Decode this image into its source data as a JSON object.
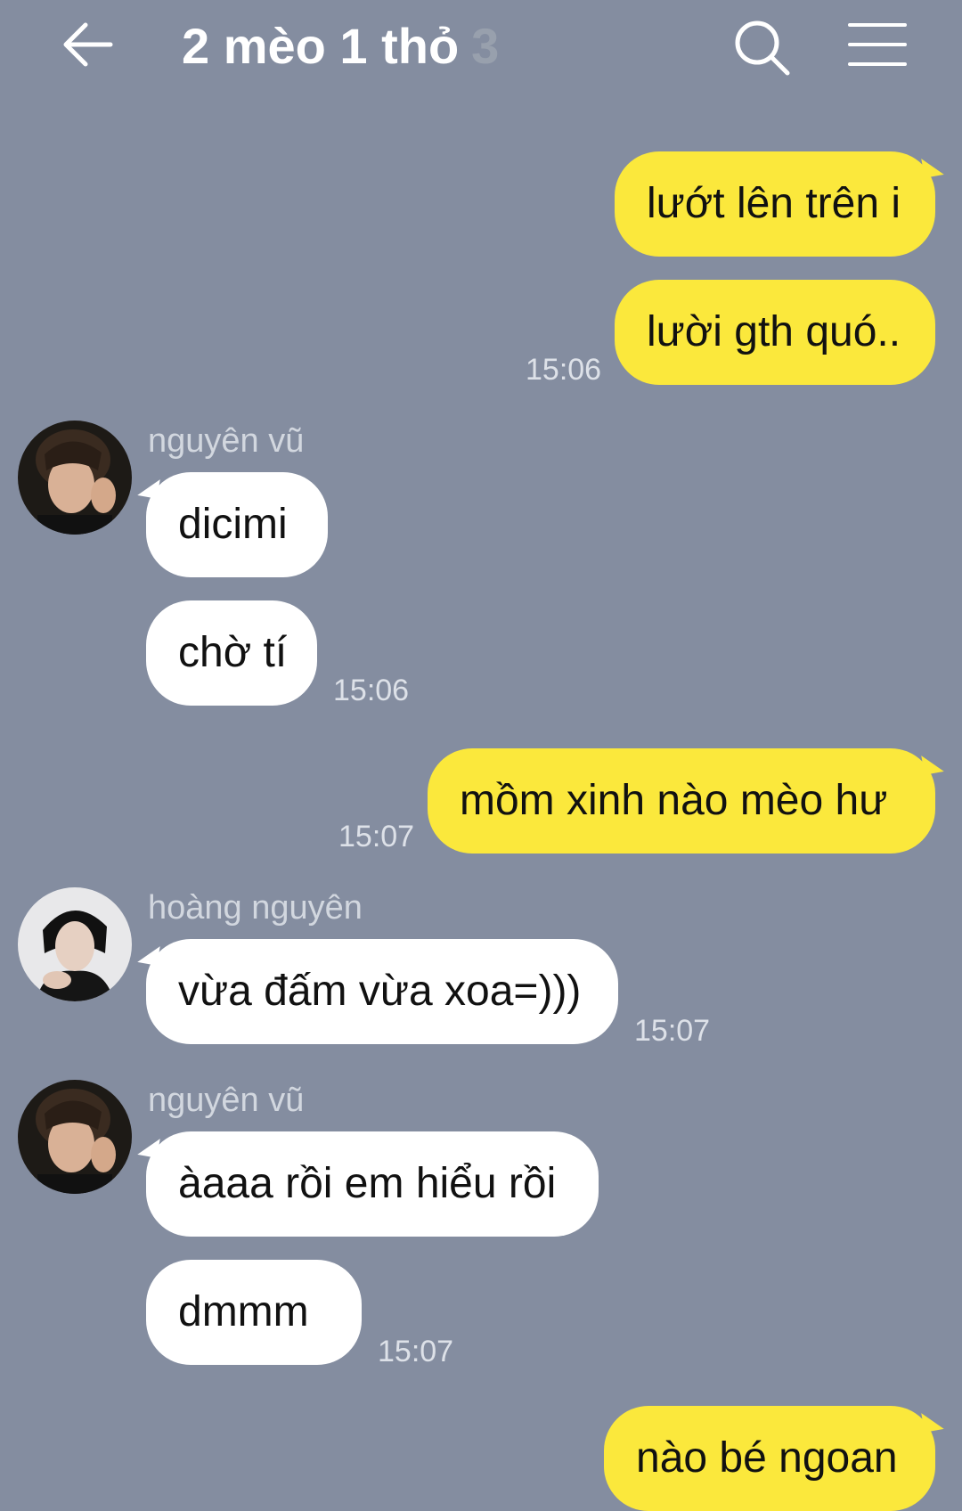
{
  "header": {
    "back_icon": "arrow-left-icon",
    "title": "2 mèo 1 thỏ",
    "member_count": "3",
    "search_icon": "search-icon",
    "menu_icon": "hamburger-menu-icon"
  },
  "messages": [
    {
      "direction": "out",
      "text": "lướt lên trên i"
    },
    {
      "direction": "out",
      "text": "lười gth quó..",
      "time": "15:06"
    },
    {
      "direction": "in",
      "sender": "nguyên vũ",
      "text": "dicimi"
    },
    {
      "direction": "in",
      "text": "chờ tí",
      "time": "15:06"
    },
    {
      "direction": "out",
      "text": "mồm xinh nào mèo hư",
      "time": "15:07"
    },
    {
      "direction": "in",
      "sender": "hoàng nguyên",
      "text": "vừa đấm vừa xoa=)))",
      "time": "15:07"
    },
    {
      "direction": "in",
      "sender": "nguyên vũ",
      "text": "àaaa rồi em hiểu rồi"
    },
    {
      "direction": "in",
      "text": "dmmm",
      "time": "15:07"
    },
    {
      "direction": "out",
      "text": "nào bé ngoan"
    }
  ],
  "colors": {
    "background": "#848da0",
    "outgoing_bubble": "#fbe83c",
    "incoming_bubble": "#ffffff"
  }
}
